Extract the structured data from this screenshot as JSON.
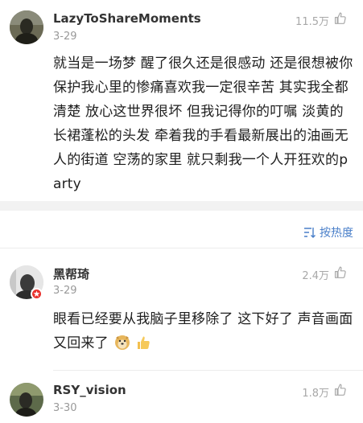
{
  "comments": [
    {
      "username": "LazyToShareMoments",
      "date": "3-29",
      "likes": "11.5万",
      "text": "就当是一场梦 醒了很久还是很感动 还是很想被你保护我心里的惨痛喜欢我一定很辛苦 其实我全都清楚 放心这世界很坏 但我记得你的叮嘱 淡黄的长裙蓬松的头发 牵着我的手看最新展出的油画无人的街道 空荡的家里 就只剩我一个人开狂欢的party"
    },
    {
      "username": "黑帮琦",
      "date": "3-29",
      "likes": "2.4万",
      "text": "眼看已经要从我脑子里移除了 这下好了 声音画面又回来了"
    },
    {
      "username": "RSY_vision",
      "date": "3-30",
      "likes": "1.8万"
    }
  ],
  "sort": {
    "label": "按热度",
    "icon": "sort-icon"
  },
  "colors": {
    "accent": "#4a7fc9",
    "badge": "#e8312d",
    "muted": "#999999"
  }
}
